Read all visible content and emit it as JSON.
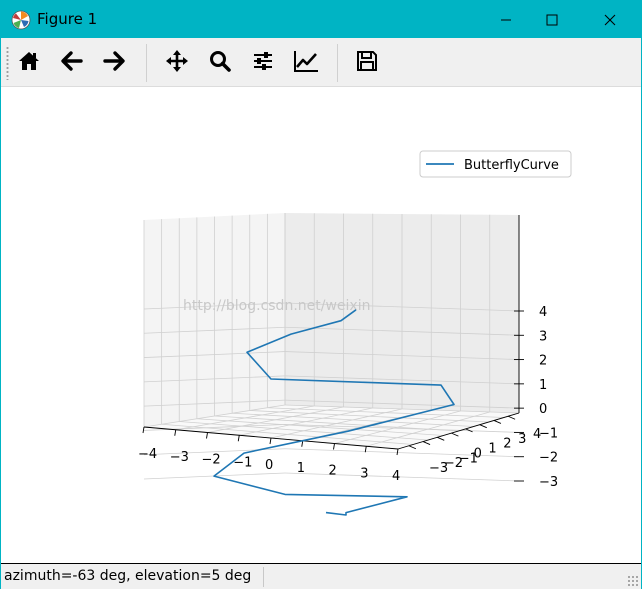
{
  "window": {
    "title": "Figure 1"
  },
  "icons": {
    "app": "matplotlib-icon",
    "minimize": "minimize-icon",
    "maximize": "maximize-icon",
    "close": "close-icon",
    "home": "home-icon",
    "back": "arrow-left-icon",
    "forward": "arrow-right-icon",
    "pan": "move-icon",
    "zoom": "magnifier-icon",
    "configure": "sliders-icon",
    "edit": "line-chart-icon",
    "save": "floppy-disk-icon"
  },
  "status": {
    "text": "azimuth=-63 deg, elevation=5 deg"
  },
  "watermark": "http://blog.csdn.net/weixin",
  "colors": {
    "titlebar": "#00b4c4",
    "series": "#1f77b4"
  },
  "chart_data": {
    "type": "line3d",
    "legend": {
      "placement": "upper-right",
      "entries": [
        "ButterflyCurve"
      ]
    },
    "x_ticks": [
      "−4",
      "−3",
      "−2",
      "−1",
      "0",
      "1",
      "2",
      "3",
      "4"
    ],
    "y_ticks": [
      "−3",
      "−2",
      "−1",
      "0",
      "1",
      "2",
      "3",
      "4"
    ],
    "z_ticks": [
      "−3",
      "−2",
      "−1",
      "0",
      "1",
      "2",
      "3",
      "4"
    ],
    "z_tick_values": [
      -3,
      -2,
      -1,
      0,
      1,
      2,
      3,
      4
    ],
    "series": [
      {
        "name": "ButterflyCurve",
        "color": "#1f77b4",
        "z": [
          -4.3,
          -4.4,
          -4.3,
          -3.65,
          -3.55,
          -2.8,
          -1.85,
          -0.95,
          0.15,
          0.95,
          1.2,
          2.3,
          3.05,
          3.6,
          4.05
        ]
      }
    ],
    "grid": true,
    "view": {
      "azimuth": -63,
      "elevation": 5
    }
  }
}
